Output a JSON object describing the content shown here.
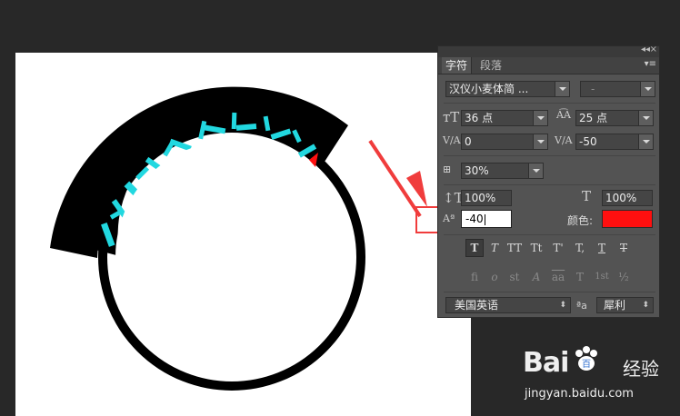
{
  "panel": {
    "tabs": [
      {
        "label": "字符",
        "active": true
      },
      {
        "label": "段落",
        "active": false
      }
    ],
    "font_family": "汉仪小麦体简 ...",
    "font_style": "-",
    "font_size": "36 点",
    "leading": "25 点",
    "kerning": "0",
    "tracking": "-50",
    "tsume": "30%",
    "vertical_scale": "100%",
    "horizontal_scale": "100%",
    "baseline_shift": "-40",
    "color_label": "颜色:",
    "color_value": "#ff0f0f",
    "style_buttons": [
      "T",
      "T",
      "TT",
      "Tt",
      "T'",
      "T,",
      "T",
      "T"
    ],
    "opentype_buttons": [
      "fi",
      "o",
      "st",
      "A",
      "aa",
      "T",
      "1st",
      "½"
    ],
    "language": "美国英语",
    "antialias_icon": "ªa",
    "antialias": "犀利"
  },
  "canvas_art": {
    "curved_text": "印章的制作示例",
    "text_color": "#22d8e0",
    "ring_color": "#000000"
  },
  "watermark": {
    "brand": "Bai",
    "brand_suffix": "百",
    "site_cn": "经验",
    "url": "jingyan.baidu.com"
  },
  "annotation": {
    "color": "#f03c3c"
  }
}
